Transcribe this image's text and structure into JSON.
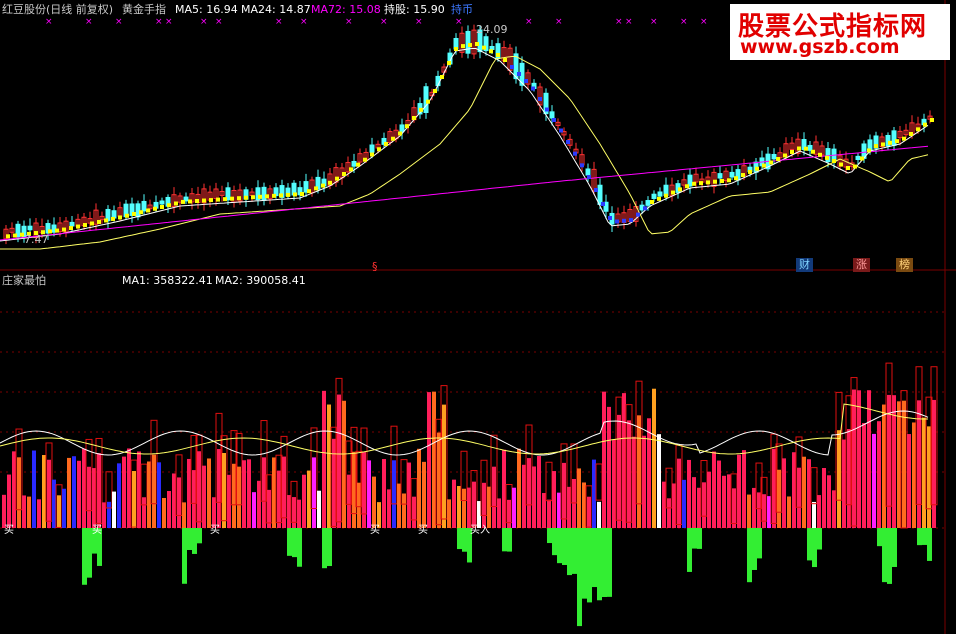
{
  "upper_panel": {
    "title": "红豆股份(日线 前复权)",
    "indicator": "黄金手指",
    "ma5": "MA5: 16.94",
    "ma24": "MA24: 14.87",
    "ma72": "MA72: 15.08",
    "hold": "持股: 15.90",
    "hold_tag": "持币",
    "peak_label": "24.09",
    "low_label": "7.47",
    "markers": [
      "财",
      "涨",
      "榜"
    ],
    "colors": {
      "ma5": "#ffffff",
      "ma24": "#ffff00",
      "ma72": "#ff00ff",
      "up": "#ff3232",
      "down": "#54ffff"
    }
  },
  "lower_panel": {
    "title": "庄家最怕",
    "ma1": "MA1: 358322.41",
    "ma2": "MA2: 390058.41",
    "buy_labels": [
      "买",
      "买",
      "买",
      "买",
      "买",
      "买入"
    ]
  },
  "watermark": {
    "title": "股票公式指标网",
    "url": "www.gszb.com"
  }
}
